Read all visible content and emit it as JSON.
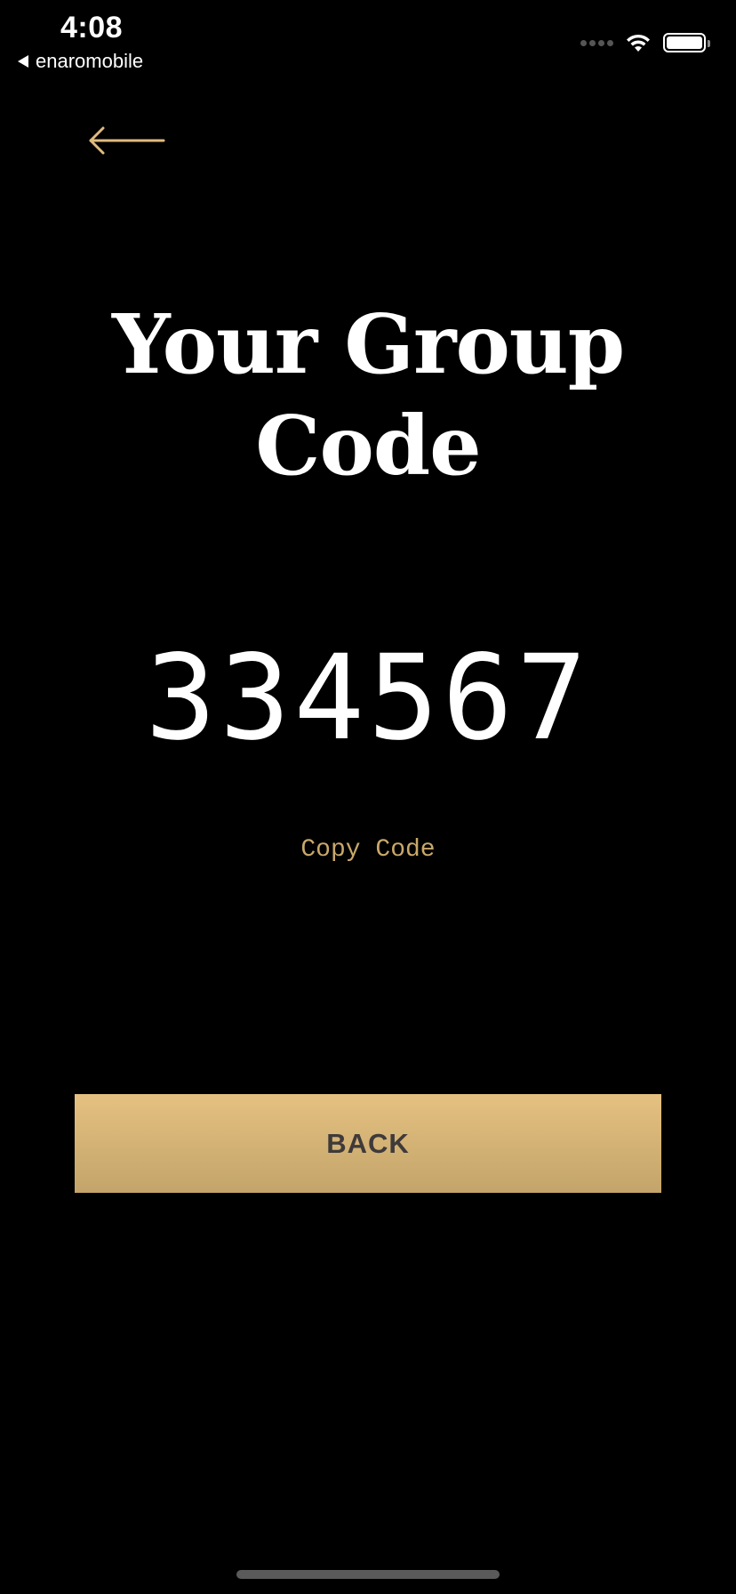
{
  "status_bar": {
    "time": "4:08",
    "back_app": "enaromobile",
    "icons": [
      "cellular-signal-icon",
      "wifi-icon",
      "battery-icon"
    ]
  },
  "nav": {
    "back_icon": "arrow-left-icon"
  },
  "title": {
    "line1": "Your Group",
    "line2": "Code"
  },
  "group_code": "334567",
  "copy_code_label": "Copy Code",
  "back_button_label": "BACK",
  "colors": {
    "background": "#000000",
    "accent_gold": "#c9a86a",
    "button_gradient_top": "#e5c181",
    "button_gradient_bottom": "#c3a46a",
    "button_text": "#3f3a3a"
  }
}
